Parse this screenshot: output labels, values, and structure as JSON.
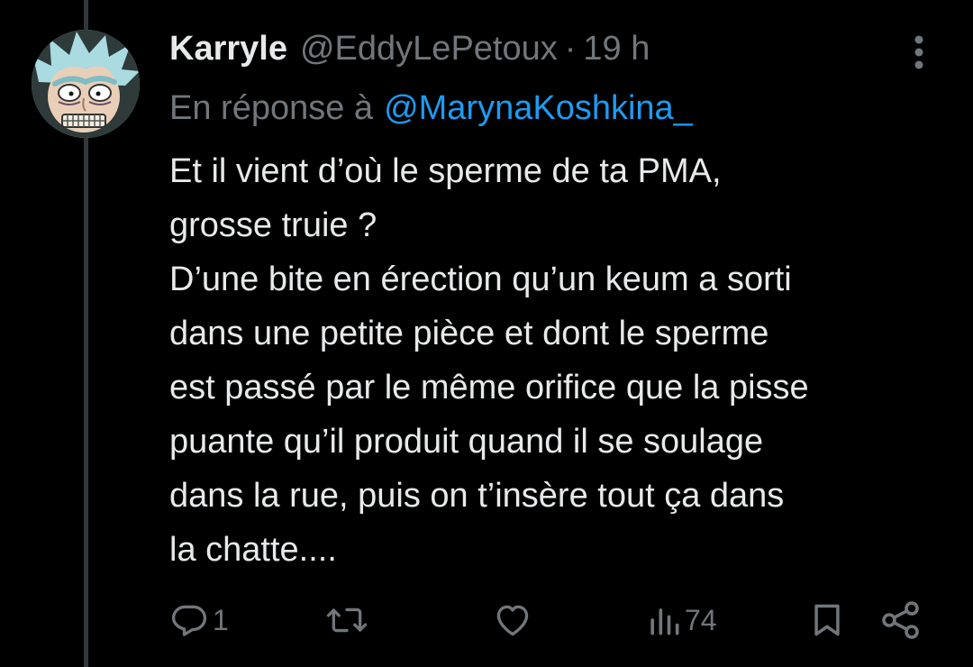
{
  "tweet": {
    "display_name": "Karryle",
    "handle": "@EddyLePetoux",
    "separator": "·",
    "time": "19 h",
    "reply_prefix": "En réponse à",
    "reply_handle": "@MarynaKoshkina_",
    "text_lines": [
      "Et il vient d’où le sperme de ta PMA,",
      "grosse truie ?",
      "D’une bite en érection qu’un keum a sorti",
      "dans une petite pièce et dont le sperme",
      "est passé par le même orifice que la pisse",
      "puante qu’il produit quand il se soulage",
      "dans la rue, puis on t’insère tout ça dans",
      "la chatte...."
    ]
  },
  "actions": {
    "reply": {
      "icon": "reply-icon",
      "count": "1"
    },
    "retweet": {
      "icon": "retweet-icon",
      "count": ""
    },
    "like": {
      "icon": "heart-icon",
      "count": ""
    },
    "views": {
      "icon": "views-icon",
      "count": "74"
    },
    "bookmark": {
      "icon": "bookmark-icon"
    },
    "share": {
      "icon": "share-icon"
    }
  },
  "colors": {
    "background": "#000000",
    "text": "#e7e9ea",
    "secondary": "#71767b",
    "link": "#1d9bf0",
    "thread_line": "#333639"
  }
}
